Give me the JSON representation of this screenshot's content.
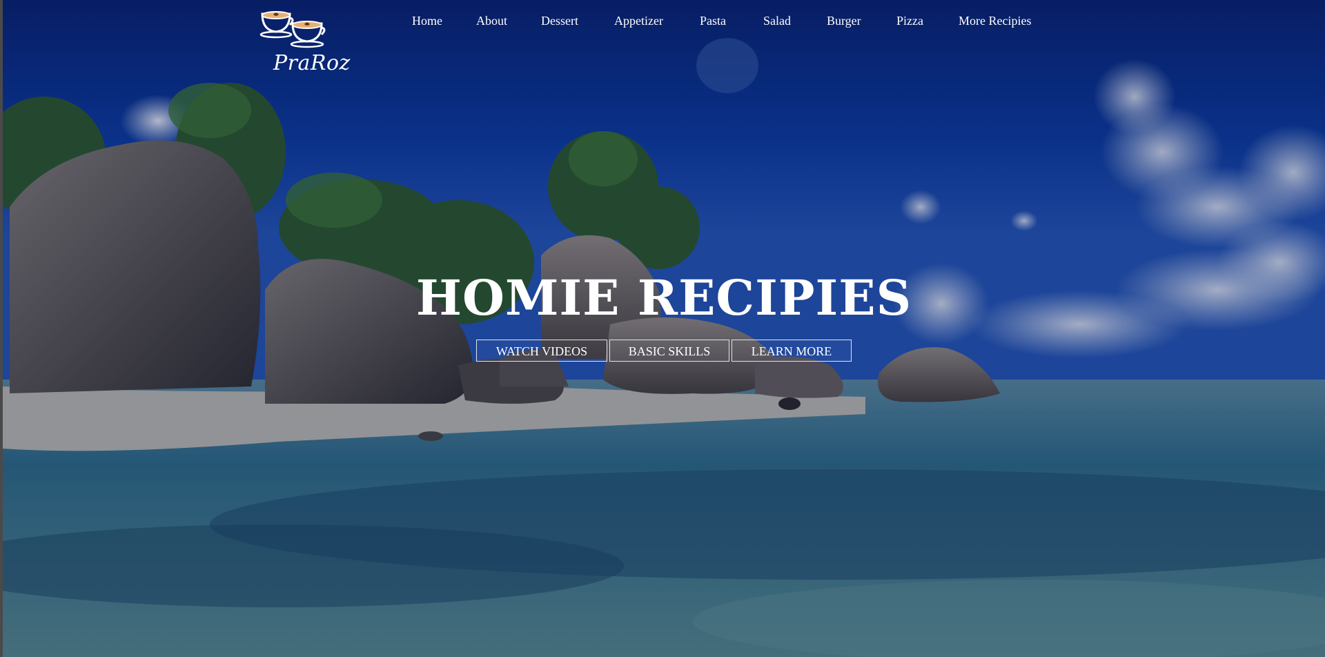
{
  "brand": {
    "name": "PraRoz",
    "logo_icon": "two-coffee-cups-with-hearts-icon"
  },
  "nav": {
    "items": [
      {
        "label": "Home"
      },
      {
        "label": "About"
      },
      {
        "label": "Dessert"
      },
      {
        "label": "Appetizer"
      },
      {
        "label": "Pasta"
      },
      {
        "label": "Salad"
      },
      {
        "label": "Burger"
      },
      {
        "label": "Pizza"
      },
      {
        "label": "More Recipies"
      }
    ]
  },
  "hero": {
    "title": "HOMIE RECIPIES",
    "buttons": [
      {
        "label": "WATCH VIDEOS"
      },
      {
        "label": "BASIC SKILLS"
      },
      {
        "label": "LEARN MORE"
      }
    ],
    "background": "tropical-beach-with-granite-rocks-and-palm-trees",
    "overlay_color": "#0a1a4a"
  },
  "colors": {
    "text": "#ffffff",
    "button_border": "#e6e6e6",
    "window_border": "#4a4a4a"
  }
}
